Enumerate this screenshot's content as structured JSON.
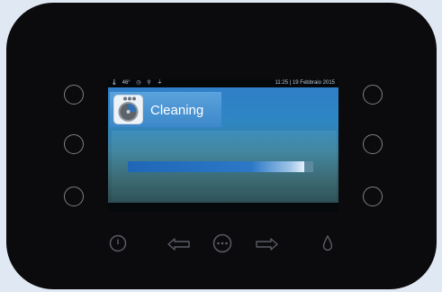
{
  "status_bar": {
    "icons": [
      "thermometer-icon",
      "clock-icon",
      "bulb-icon",
      "wifi-icon"
    ],
    "temperature": "46°",
    "time": "11:25",
    "date": "19 Febbraio 2015"
  },
  "header": {
    "title": "Cleaning",
    "icon": "cleaning-icon"
  },
  "progress": {
    "value": 0.95
  },
  "controls": {
    "power": "power-icon",
    "left": "arrow-left-icon",
    "menu": "menu-icon",
    "right": "arrow-right-icon",
    "drop": "drop-icon"
  },
  "colors": {
    "device": "#0b0a0c",
    "screen_blue": "#2f7fc8",
    "progress_fill": "#1f66b8",
    "controls": "#5a5d66"
  }
}
